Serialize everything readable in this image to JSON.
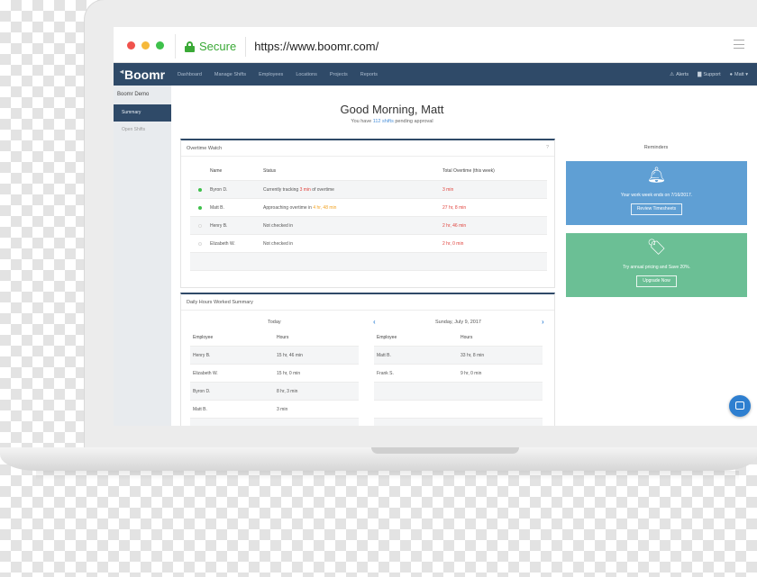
{
  "browser": {
    "secure_label": "Secure",
    "url": "https://www.boomr.com/"
  },
  "app": {
    "logo": "Boomr",
    "nav": [
      "Dashboard",
      "Manage Shifts",
      "Employees",
      "Locations",
      "Projects",
      "Reports"
    ],
    "nav_right": {
      "alerts": "Alerts",
      "support": "Support",
      "user": "Matt"
    }
  },
  "sidebar": {
    "title": "Boomr Demo",
    "items": [
      "Summary",
      "Open Shifts"
    ]
  },
  "greeting": {
    "title": "Good Morning, Matt",
    "pending_prefix": "You have ",
    "pending_link": "112 shifts",
    "pending_suffix": " pending approval"
  },
  "overtime": {
    "title": "Overtime Watch",
    "help": "?",
    "headers": [
      "Name",
      "Status",
      "Total Overtime (this week)"
    ],
    "rows": [
      {
        "name": "Byron D.",
        "status_pre": "Currently tracking ",
        "status_hl": "3 min",
        "status_post": " of overtime",
        "total": "3 min",
        "active": true
      },
      {
        "name": "Matt B.",
        "status_pre": "Approaching overtime in ",
        "status_hl": "4 hr, 48 min",
        "status_post": "",
        "total": "27 hr, 8 min",
        "active": true
      },
      {
        "name": "Henry B.",
        "status_pre": "Not checked in",
        "status_hl": "",
        "status_post": "",
        "total": "2 hr, 46 min",
        "active": false
      },
      {
        "name": "Elizabeth W.",
        "status_pre": "Not checked in",
        "status_hl": "",
        "status_post": "",
        "total": "2 hr, 0 min",
        "active": false
      }
    ]
  },
  "daily_hours": {
    "title": "Daily Hours Worked Summary",
    "today_label": "Today",
    "date_label": "Sunday, July 9, 2017",
    "headers": [
      "Employee",
      "Hours"
    ],
    "today": [
      {
        "employee": "Henry B.",
        "hours": "15 hr, 46 min"
      },
      {
        "employee": "Elizabeth W.",
        "hours": "15 hr, 0 min"
      },
      {
        "employee": "Byron D.",
        "hours": "8 hr, 3 min"
      },
      {
        "employee": "Matt B.",
        "hours": "3 min"
      }
    ],
    "other": [
      {
        "employee": "Matt B.",
        "hours": "33 hr, 8 min"
      },
      {
        "employee": "Frank S.",
        "hours": "9 hr, 0 min"
      }
    ]
  },
  "reminders": {
    "title": "Reminders",
    "cards": [
      {
        "icon": "bell-icon",
        "text": "Your work week ends on 7/16/2017.",
        "button": "Review Timesheets",
        "color": "#5f9fd4"
      },
      {
        "icon": "tags-icon",
        "text": "Try annual pricing and Save 20%.",
        "button": "Upgrade Now",
        "color": "#6bbf95"
      }
    ]
  }
}
